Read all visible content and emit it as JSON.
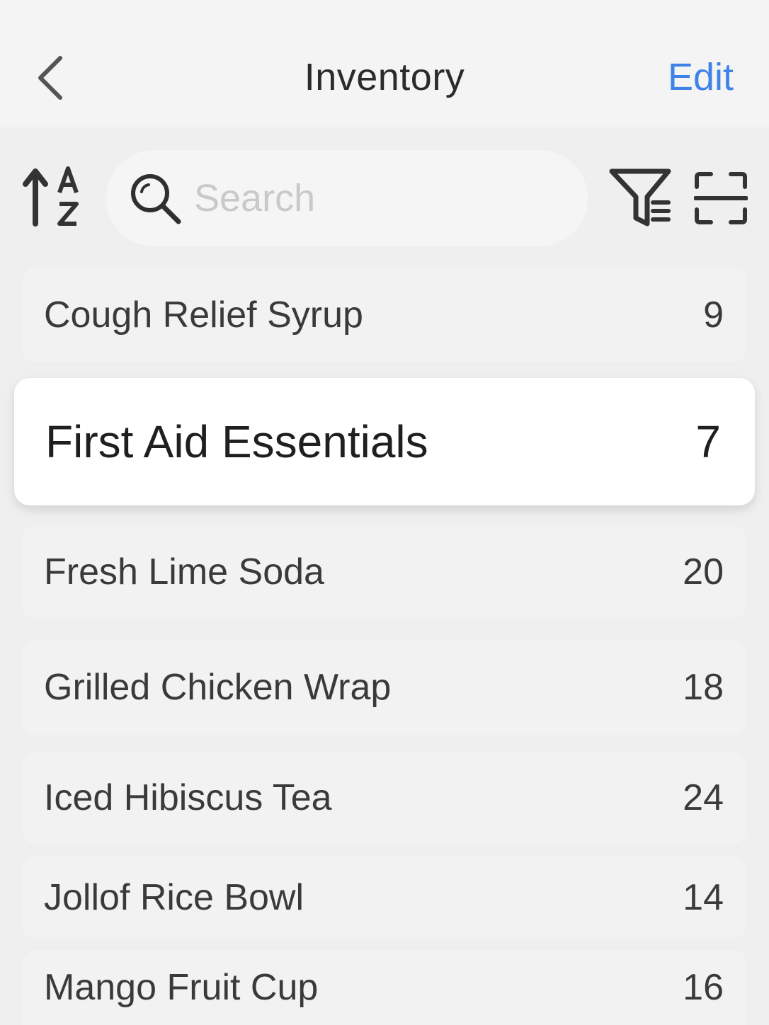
{
  "header": {
    "back_icon": "chevron-left-icon",
    "title": "Inventory",
    "edit_label": "Edit",
    "accent_color": "#3f82e8"
  },
  "toolbar": {
    "sort_icon": "sort-alpha-ascending-icon",
    "search_icon": "search-icon",
    "search_placeholder": "Search",
    "search_value": "",
    "filter_icon": "filter-list-icon",
    "scan_icon": "scan-icon"
  },
  "items": [
    {
      "name": "Cough Relief Syrup",
      "count": "9",
      "selected": false
    },
    {
      "name": "First Aid Essentials",
      "count": "7",
      "selected": true
    },
    {
      "name": "Fresh Lime Soda",
      "count": "20",
      "selected": false
    },
    {
      "name": "Grilled Chicken Wrap",
      "count": "18",
      "selected": false
    },
    {
      "name": "Iced Hibiscus Tea",
      "count": "24",
      "selected": false
    },
    {
      "name": "Jollof Rice Bowl",
      "count": "14",
      "selected": false
    },
    {
      "name": "Mango Fruit Cup",
      "count": "16",
      "selected": false
    }
  ]
}
